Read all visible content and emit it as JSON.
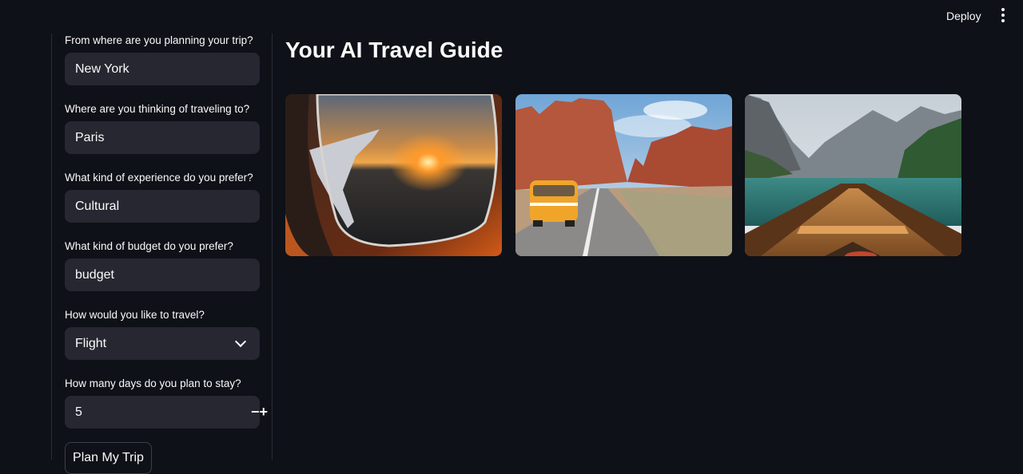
{
  "header": {
    "deploy_label": "Deploy",
    "menu_icon": "more-vertical-icon"
  },
  "sidebar": {
    "origin": {
      "label": "From where are you planning your trip?",
      "value": "New York"
    },
    "destination": {
      "label": "Where are you thinking of traveling to?",
      "value": "Paris"
    },
    "experience": {
      "label": "What kind of experience do you prefer?",
      "value": "Cultural"
    },
    "budget": {
      "label": "What kind of budget do you prefer?",
      "value": "budget"
    },
    "travel_mode": {
      "label": "How would you like to travel?",
      "selected": "Flight"
    },
    "days": {
      "label": "How many days do you plan to stay?",
      "value": "5",
      "minus": "−",
      "plus": "+"
    },
    "submit_label": "Plan My Trip"
  },
  "main": {
    "title": "Your AI Travel Guide",
    "images": [
      "airplane-window-sunset-image",
      "van-on-desert-road-image",
      "boat-on-mountain-lake-image"
    ]
  },
  "colors": {
    "background": "#0e1117",
    "input_bg": "#262730",
    "text": "#fafafa",
    "divider": "#2a2d36"
  }
}
